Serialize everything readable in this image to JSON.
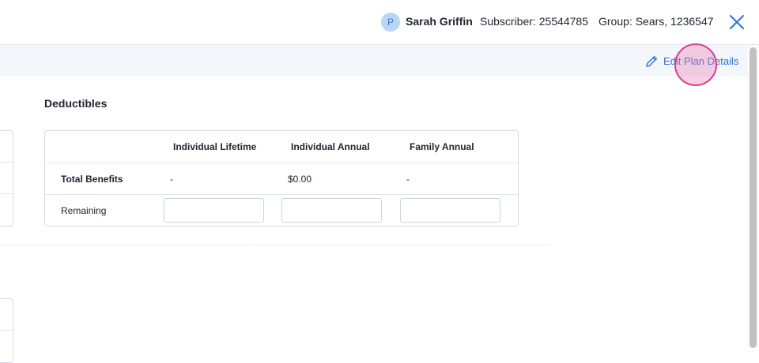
{
  "header": {
    "avatar_initial": "P",
    "user_name": "Sarah Griffin",
    "subscriber": "Subscriber: 25544785",
    "group": "Group: Sears, 1236547"
  },
  "toolbar": {
    "edit_label": "Edit Plan Details"
  },
  "deductibles": {
    "title": "Deductibles",
    "columns": [
      "",
      "Individual Lifetime",
      "Individual Annual",
      "Family Annual"
    ],
    "rows": [
      {
        "label": "Total Benefits",
        "values": [
          "-",
          "$0.00",
          "-"
        ]
      },
      {
        "label": "Remaining",
        "values": [
          "",
          "",
          ""
        ]
      }
    ]
  },
  "colors": {
    "accent": "#2f6fe0",
    "highlight": "#d9418a"
  }
}
